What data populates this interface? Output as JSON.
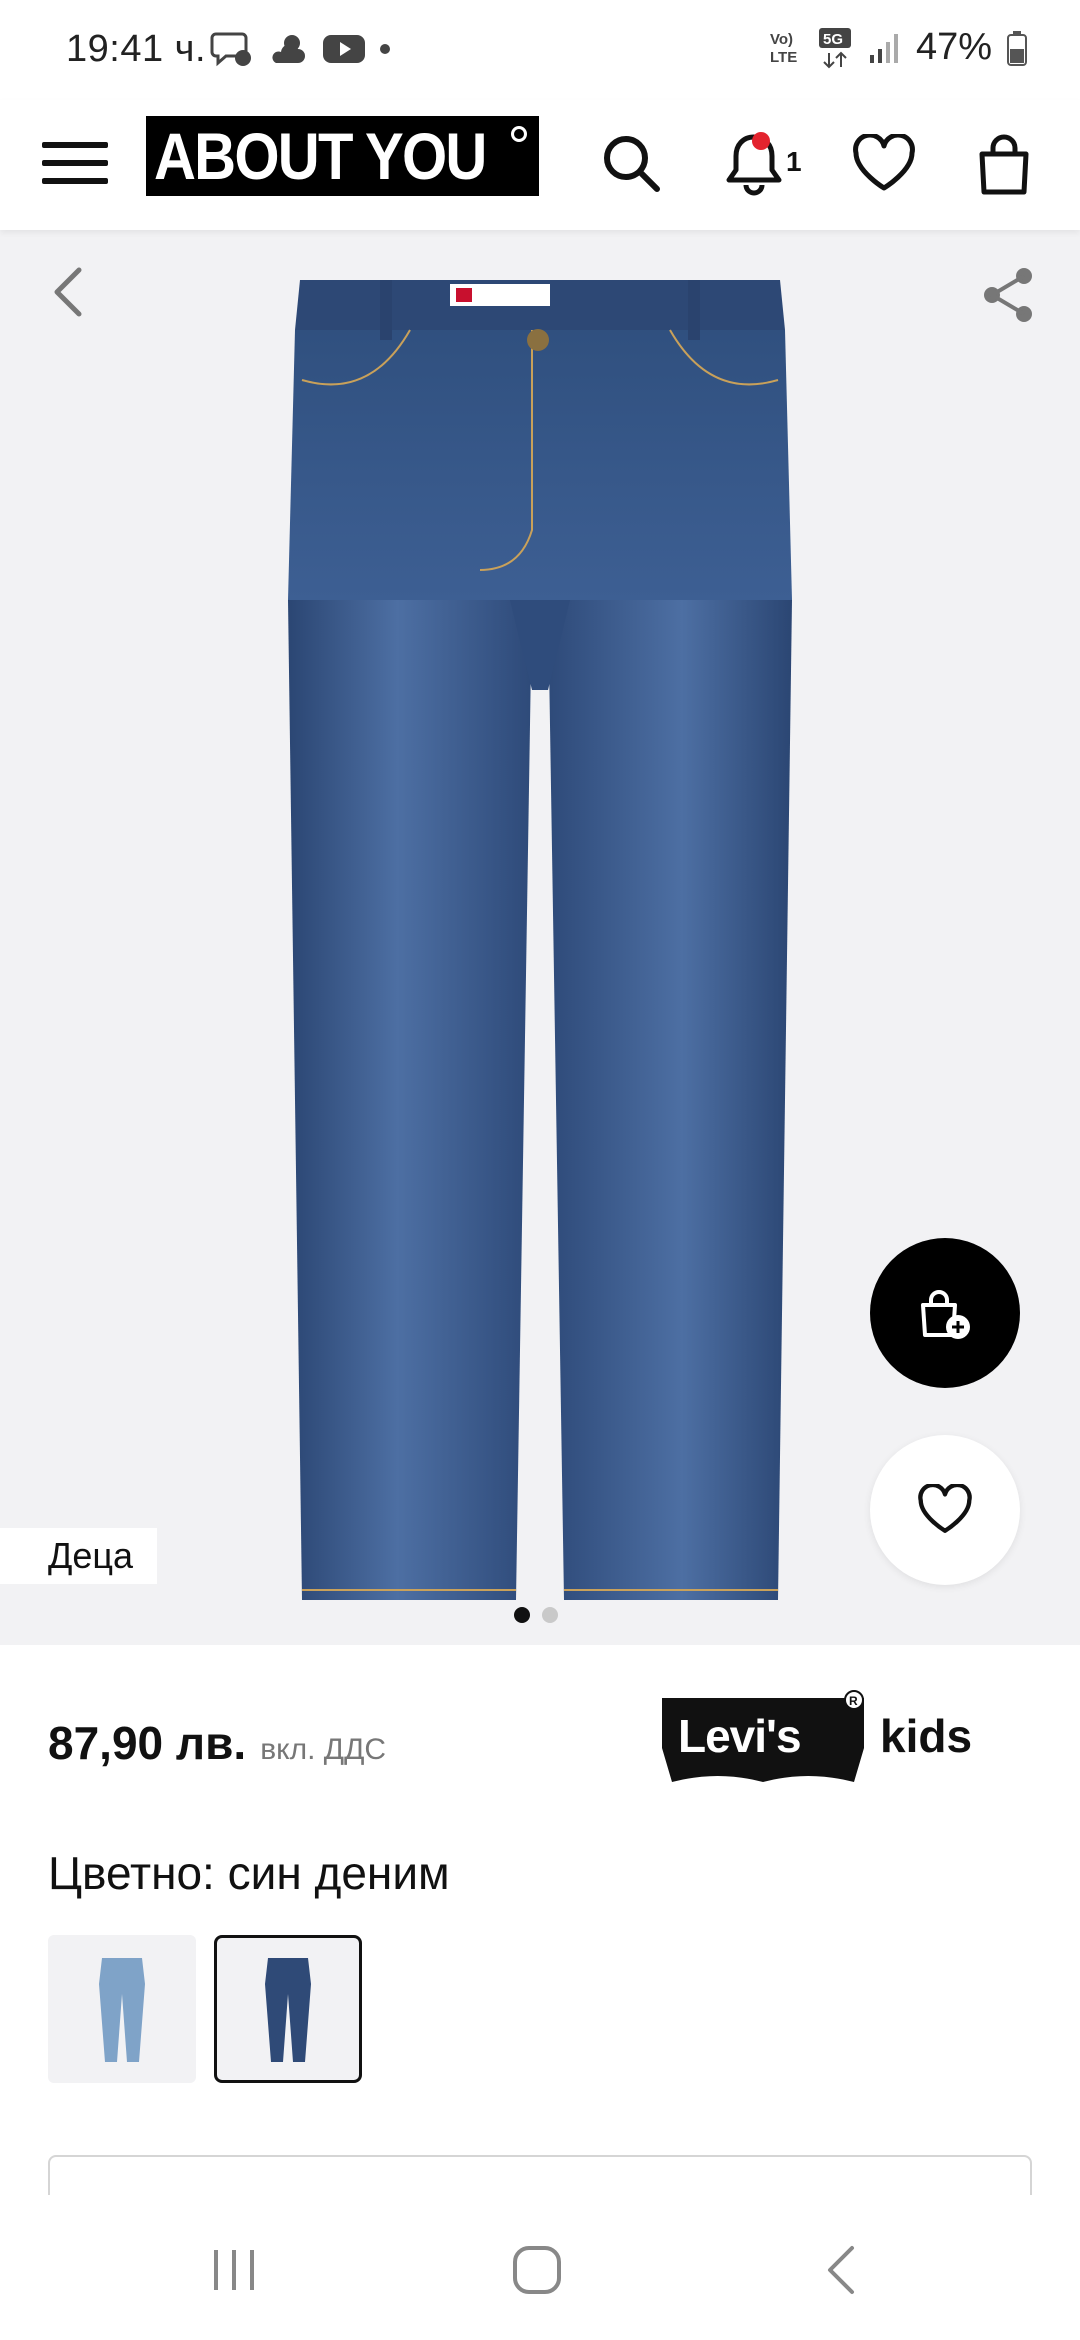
{
  "status_bar": {
    "time": "19:41 ч.",
    "battery": "47%",
    "network": "5G"
  },
  "header": {
    "logo_text": "ABOUT YOU",
    "notification_count": "1"
  },
  "gallery": {
    "category_tag": "Деца",
    "page_count": 2,
    "active_page": 1
  },
  "product": {
    "price": "87,90 лв.",
    "vat_note": "вкл. ДДС",
    "brand": "Levi's Kids",
    "color_label": "Цветно: син деним",
    "swatches": [
      {
        "name": "light-blue-denim",
        "color": "#7fa3c8",
        "selected": false
      },
      {
        "name": "blue-denim",
        "color": "#2f4a77",
        "selected": true
      }
    ]
  },
  "colors": {
    "accent": "#000000",
    "badge": "#e3232e",
    "denim": "#3a5a8c",
    "background": "#f2f2f4"
  }
}
